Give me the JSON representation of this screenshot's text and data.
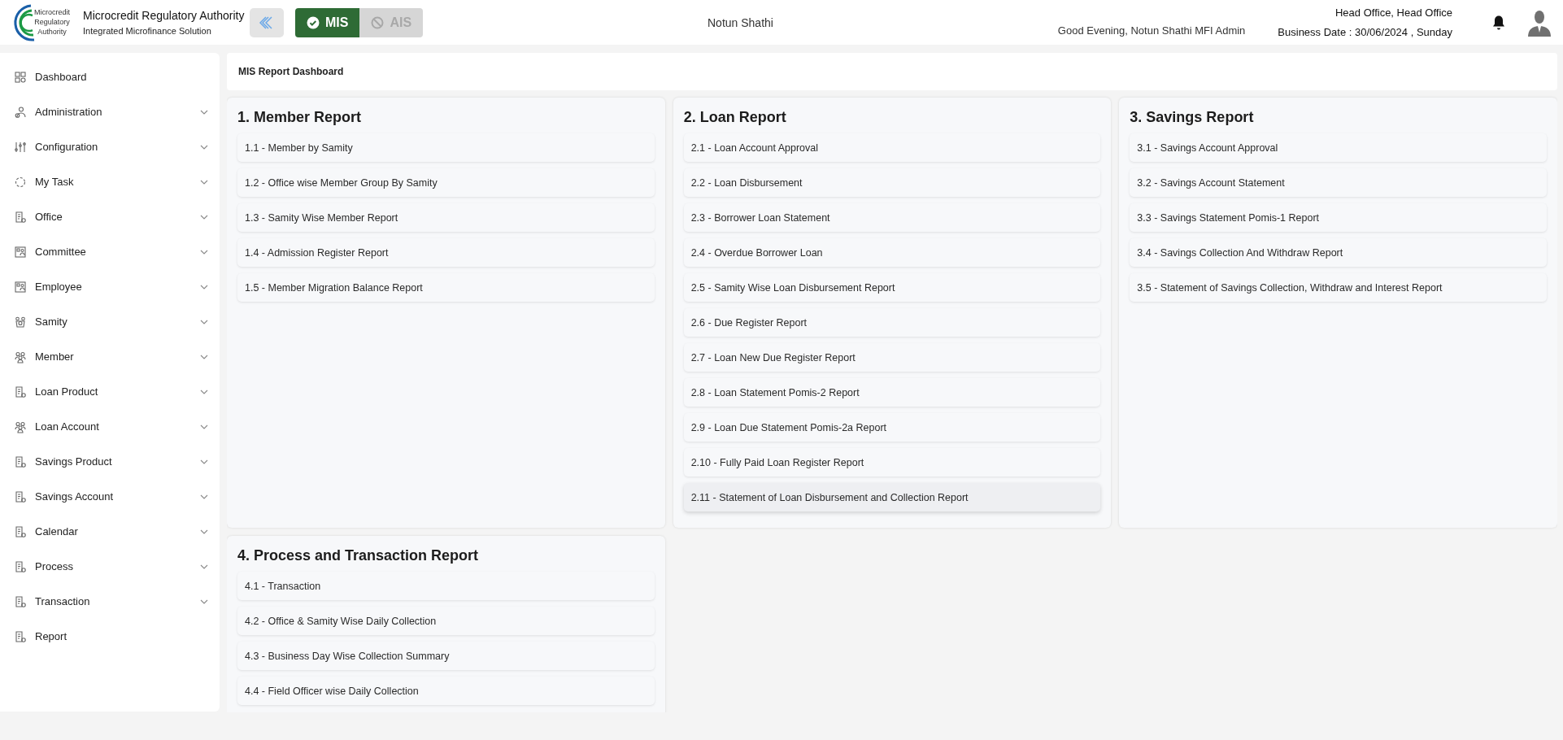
{
  "header": {
    "org_name": "Microcredit Regulatory Authority",
    "org_subtitle": "Integrated Microfinance Solution",
    "logo_text": [
      "Microcredit",
      "Regulatory",
      "Authority"
    ],
    "modules": [
      {
        "label": "MIS",
        "selected": true
      },
      {
        "label": "AIS",
        "selected": false
      }
    ],
    "center_title": "Notun Shathi",
    "greeting": "Good Evening, Notun Shathi MFI Admin",
    "office": "Head Office, Head Office",
    "business_date": "Business Date : 30/06/2024 , Sunday"
  },
  "sidebar": {
    "items": [
      {
        "label": "Dashboard",
        "expandable": false
      },
      {
        "label": "Administration",
        "expandable": true
      },
      {
        "label": "Configuration",
        "expandable": true
      },
      {
        "label": "My Task",
        "expandable": true
      },
      {
        "label": "Office",
        "expandable": true
      },
      {
        "label": "Committee",
        "expandable": true
      },
      {
        "label": "Employee",
        "expandable": true
      },
      {
        "label": "Samity",
        "expandable": true
      },
      {
        "label": "Member",
        "expandable": true
      },
      {
        "label": "Loan Product",
        "expandable": true
      },
      {
        "label": "Loan Account",
        "expandable": true
      },
      {
        "label": "Savings Product",
        "expandable": true
      },
      {
        "label": "Savings Account",
        "expandable": true
      },
      {
        "label": "Calendar",
        "expandable": true
      },
      {
        "label": "Process",
        "expandable": true
      },
      {
        "label": "Transaction",
        "expandable": true
      },
      {
        "label": "Report",
        "expandable": false
      }
    ]
  },
  "page_title": "MIS Report Dashboard",
  "report_groups": [
    {
      "title": "1. Member Report",
      "items": [
        {
          "label": "1.1 - Member by Samity",
          "hovered": false
        },
        {
          "label": "1.2 - Office wise Member Group By Samity",
          "hovered": false
        },
        {
          "label": "1.3 - Samity Wise Member Report",
          "hovered": false
        },
        {
          "label": "1.4 - Admission Register Report",
          "hovered": false
        },
        {
          "label": "1.5 - Member Migration Balance Report",
          "hovered": false
        }
      ]
    },
    {
      "title": "2. Loan Report",
      "items": [
        {
          "label": "2.1 - Loan Account Approval",
          "hovered": false
        },
        {
          "label": "2.2 - Loan Disbursement",
          "hovered": false
        },
        {
          "label": "2.3 - Borrower Loan Statement",
          "hovered": false
        },
        {
          "label": "2.4 - Overdue Borrower Loan",
          "hovered": false
        },
        {
          "label": "2.5 - Samity Wise Loan Disbursement Report",
          "hovered": false
        },
        {
          "label": "2.6 - Due Register Report",
          "hovered": false
        },
        {
          "label": "2.7 - Loan New Due Register Report",
          "hovered": false
        },
        {
          "label": "2.8 - Loan Statement Pomis-2 Report",
          "hovered": false
        },
        {
          "label": "2.9 - Loan Due Statement Pomis-2a Report",
          "hovered": false
        },
        {
          "label": "2.10 - Fully Paid Loan Register Report",
          "hovered": false
        },
        {
          "label": "2.11 - Statement of Loan Disbursement and Collection Report",
          "hovered": true
        }
      ]
    },
    {
      "title": "3. Savings Report",
      "items": [
        {
          "label": "3.1 - Savings Account Approval",
          "hovered": false
        },
        {
          "label": "3.2 - Savings Account Statement",
          "hovered": false
        },
        {
          "label": "3.3 - Savings Statement Pomis-1 Report",
          "hovered": false
        },
        {
          "label": "3.4 - Savings Collection And Withdraw Report",
          "hovered": false
        },
        {
          "label": "3.5 - Statement of Savings Collection, Withdraw and Interest Report",
          "hovered": false
        }
      ]
    },
    {
      "title": "4. Process and Transaction Report",
      "items": [
        {
          "label": "4.1 - Transaction",
          "hovered": false
        },
        {
          "label": "4.2 - Office & Samity Wise Daily Collection",
          "hovered": false
        },
        {
          "label": "4.3 - Business Day Wise Collection Summary",
          "hovered": false
        },
        {
          "label": "4.4 - Field Officer wise Daily Collection",
          "hovered": false
        }
      ]
    }
  ]
}
